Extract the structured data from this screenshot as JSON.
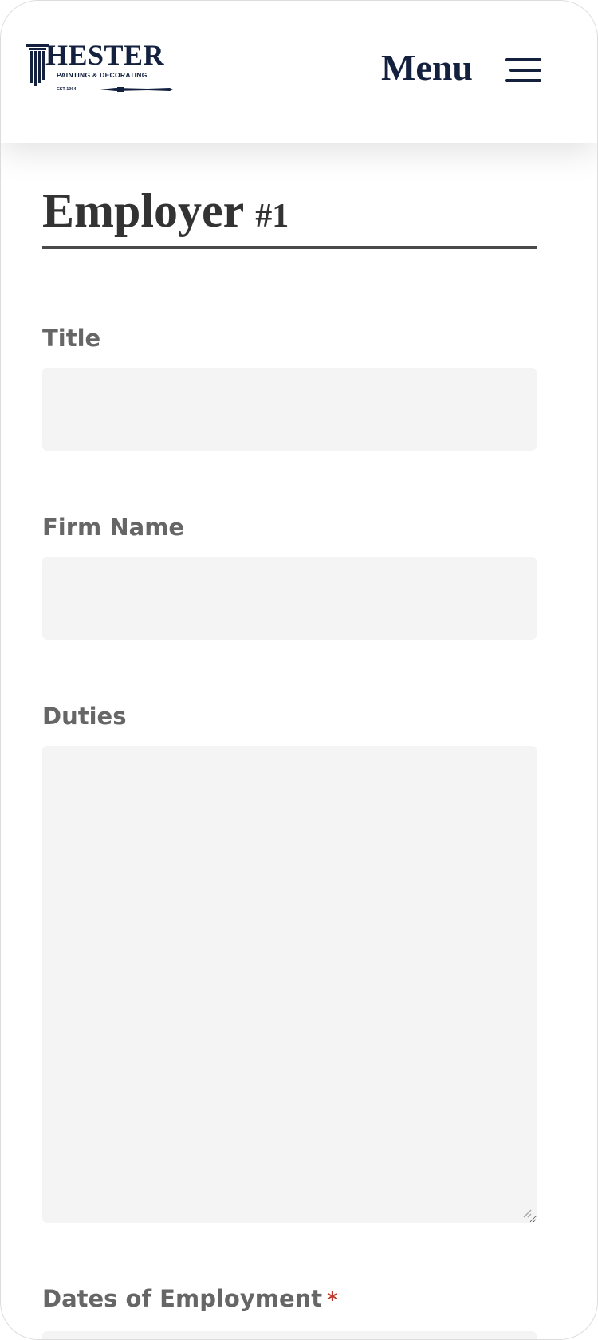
{
  "header": {
    "logo": {
      "name": "HESTER",
      "tagline": "PAINTING & DECORATING",
      "est": "EST 1964"
    },
    "menu_label": "Menu",
    "menu_icon": "hamburger-icon"
  },
  "form": {
    "section_title": "Employer",
    "section_number": "#1",
    "fields": {
      "title": {
        "label": "Title",
        "value": ""
      },
      "firm_name": {
        "label": "Firm Name",
        "value": ""
      },
      "duties": {
        "label": "Duties",
        "value": ""
      },
      "dates_of_employment": {
        "label": "Dates of Employment",
        "required_mark": "*",
        "value": ""
      }
    }
  },
  "colors": {
    "brand_navy": "#13213f",
    "label_gray": "#666666",
    "input_bg": "#f4f4f4",
    "required_red": "#c0392b"
  }
}
